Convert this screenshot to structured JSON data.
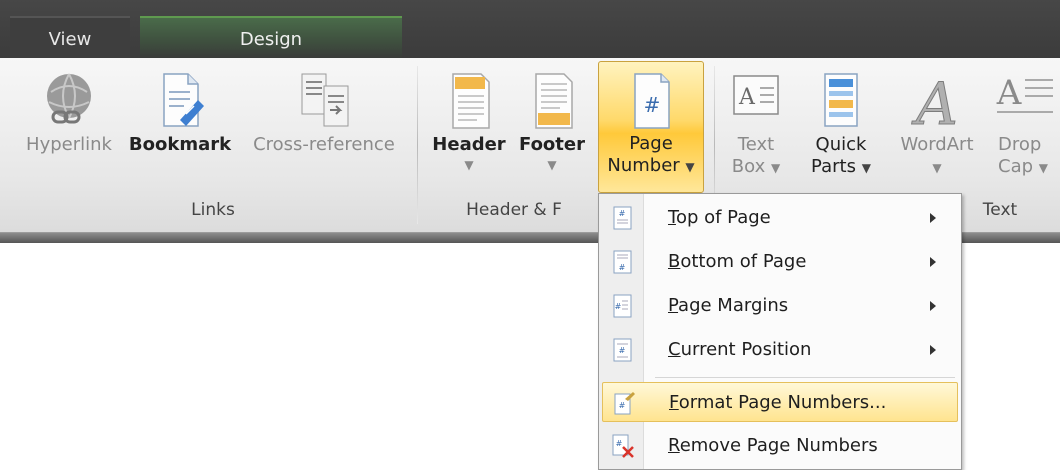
{
  "tabs": [
    {
      "label": "View"
    },
    {
      "label": "Design"
    }
  ],
  "ribbon": {
    "links": {
      "hyperlink": "Hyperlink",
      "bookmark": "Bookmark",
      "cross_reference": "Cross-reference",
      "group_label": "Links"
    },
    "header_footer": {
      "header": "Header",
      "footer": "Footer",
      "page_line1": "Page",
      "page_line2": "Number",
      "group_label": "Header & F"
    },
    "text": {
      "text_box_line1": "Text",
      "text_box_line2": "Box",
      "quick_parts_line1": "Quick",
      "quick_parts_line2": "Parts",
      "wordart": "WordArt",
      "drop_cap_line1": "Drop",
      "drop_cap_line2": "Cap",
      "group_label": "Text"
    }
  },
  "menu": {
    "items": [
      {
        "accel": "T",
        "rest": "op of Page",
        "submenu": true
      },
      {
        "accel": "B",
        "rest": "ottom of Page",
        "submenu": true
      },
      {
        "accel": "P",
        "rest": "age Margins",
        "submenu": true
      },
      {
        "accel": "C",
        "rest": "urrent Position",
        "submenu": true
      },
      {
        "accel": "F",
        "rest": "ormat Page Numbers...",
        "submenu": false
      },
      {
        "accel": "R",
        "rest": "emove Page Numbers",
        "submenu": false
      }
    ]
  },
  "colors": {
    "accent_design_tab": "#5f9a4f",
    "highlight": "#ffd96a"
  }
}
